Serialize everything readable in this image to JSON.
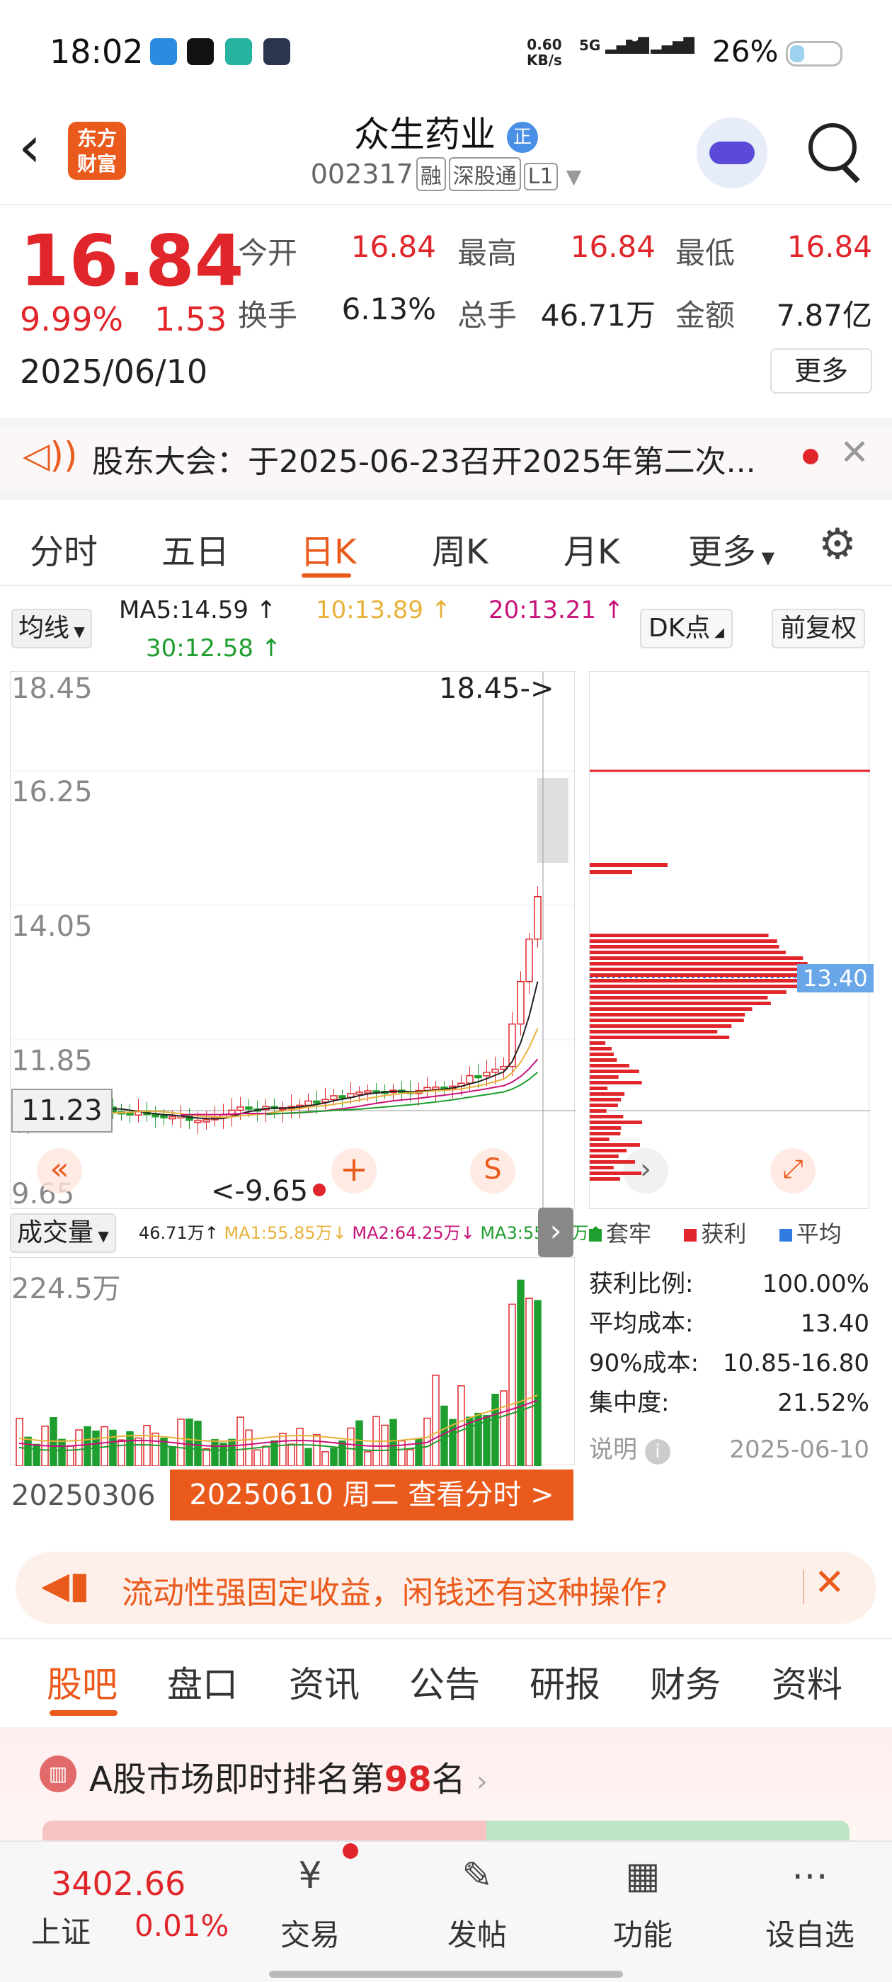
{
  "status": {
    "time": "18:02",
    "net_speed": "0.60",
    "net_unit": "KB/s",
    "sig1": "5G",
    "sig2": "5G",
    "battery": "26%"
  },
  "header": {
    "logo_line1": "东方",
    "logo_line2": "财富",
    "stock_name": "众生药业",
    "badge": "正",
    "code": "002317",
    "tags": [
      "融",
      "深股通",
      "L1"
    ]
  },
  "quote": {
    "price": "16.84",
    "change_pct": "9.99%",
    "change": "1.53",
    "date": "2025/06/10",
    "open_label": "今开",
    "open": "16.84",
    "high_label": "最高",
    "high": "16.84",
    "low_label": "最低",
    "low": "16.84",
    "turnover_label": "换手",
    "turnover": "6.13%",
    "volume_label": "总手",
    "volume": "46.71万",
    "amount_label": "金额",
    "amount": "7.87亿",
    "more": "更多"
  },
  "notice": {
    "text": "股东大会：于2025-06-23召开2025年第二次..."
  },
  "period_tabs": [
    "分时",
    "五日",
    "日K",
    "周K",
    "月K",
    "更多"
  ],
  "ma": {
    "selector": "均线",
    "ma5": "MA5:14.59 ↑",
    "ma10": "10:13.89 ↑",
    "ma20": "20:13.21 ↑",
    "ma30": "30:12.58 ↑",
    "dk": "DK点",
    "adjust": "前复权"
  },
  "kchart": {
    "y_ticks": [
      "18.45",
      "16.25",
      "14.05",
      "11.85",
      "9.65"
    ],
    "max_label": "18.45->",
    "min_label": "<-9.65",
    "crosshair_price": "11.23",
    "colors": {
      "up": "#e0262b",
      "down": "#1e9e2e",
      "ma5": "#222222",
      "ma10": "#e8b13a",
      "ma20": "#c8137a",
      "ma30": "#1e9e2e"
    }
  },
  "chip": {
    "avg_cost_tag": "13.40",
    "legend": [
      "套牢",
      "获利",
      "平均"
    ],
    "rows": [
      {
        "label": "获利比例:",
        "value": "100.00%"
      },
      {
        "label": "平均成本:",
        "value": "13.40"
      },
      {
        "label": "90%成本:",
        "value": "10.85-16.80"
      },
      {
        "label": "集中度:",
        "value": "21.52%"
      }
    ],
    "note_label": "说明",
    "note_date": "2025-06-10"
  },
  "volume": {
    "selector": "成交量",
    "vol": "46.71万↑",
    "ma1": "MA1:55.85万↓",
    "ma2": "MA2:64.25万↓",
    "ma3": "MA3:55.02万↑",
    "max_label": "224.5万",
    "start_date": "20250306",
    "end_button": "20250610 周二 查看分时 >"
  },
  "ad": {
    "text": "流动性强固定收益，闲钱还有这种操作?"
  },
  "info_tabs": [
    "股吧",
    "盘口",
    "资讯",
    "公告",
    "研报",
    "财务",
    "资料"
  ],
  "ranking": {
    "prefix": "A股市场即时排名第",
    "rank": "98",
    "suffix": "名"
  },
  "bottom_nav": {
    "index_value": "3402.66",
    "index_name": "上证",
    "index_change": "0.01%",
    "items": [
      "交易",
      "发帖",
      "功能",
      "设自选"
    ]
  }
}
